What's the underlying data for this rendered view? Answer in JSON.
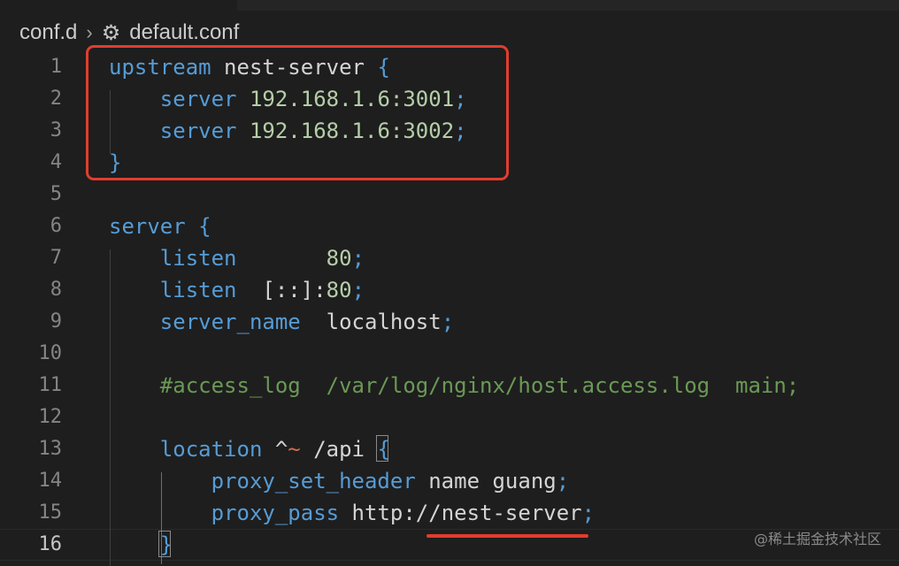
{
  "breadcrumb": {
    "folder": "conf.d",
    "separator_icon": "chevron-right-icon",
    "file_icon": "gear-icon",
    "file": "default.conf"
  },
  "colors": {
    "background": "#1e1e1e",
    "keyword": "#569cd6",
    "directive": "#4fa7e3",
    "number": "#b5cea8",
    "comment": "#6a9955",
    "text": "#d4d4d4",
    "highlight": "#e03d2f"
  },
  "editor": {
    "active_line": "16",
    "lines": [
      {
        "n": "1",
        "code": "upstream nest-server {"
      },
      {
        "n": "2",
        "code": "    server 192.168.1.6:3001;"
      },
      {
        "n": "3",
        "code": "    server 192.168.1.6:3002;"
      },
      {
        "n": "4",
        "code": "}"
      },
      {
        "n": "5",
        "code": ""
      },
      {
        "n": "6",
        "code": "server {"
      },
      {
        "n": "7",
        "code": "    listen       80;"
      },
      {
        "n": "8",
        "code": "    listen  [::]:80;"
      },
      {
        "n": "9",
        "code": "    server_name  localhost;"
      },
      {
        "n": "10",
        "code": ""
      },
      {
        "n": "11",
        "code": "    #access_log  /var/log/nginx/host.access.log  main;"
      },
      {
        "n": "12",
        "code": ""
      },
      {
        "n": "13",
        "code": "    location ^~ /api {"
      },
      {
        "n": "14",
        "code": "        proxy_set_header name guang;"
      },
      {
        "n": "15",
        "code": "        proxy_pass http://nest-server;"
      },
      {
        "n": "16",
        "code": "    }"
      }
    ]
  },
  "watermark": "@稀土掘金技术社区"
}
